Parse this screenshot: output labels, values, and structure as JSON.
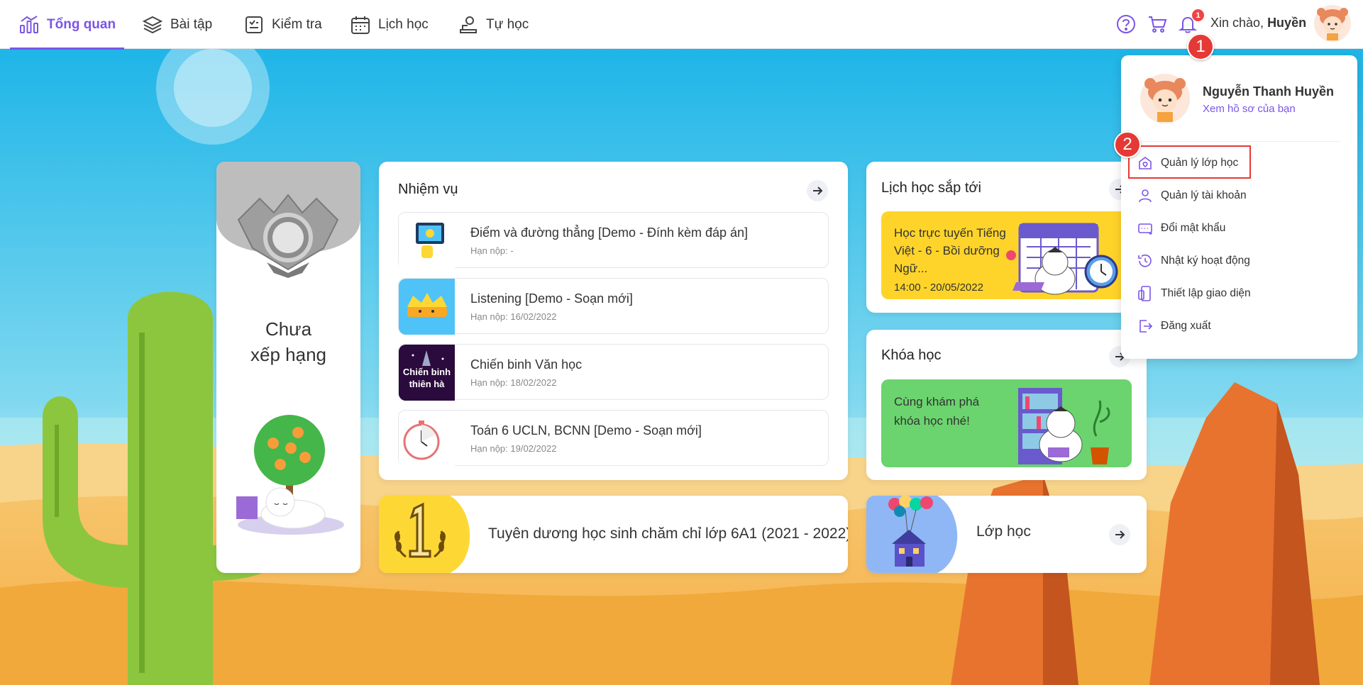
{
  "nav": {
    "items": [
      {
        "label": "Tổng quan",
        "icon": "chart-icon",
        "active": true
      },
      {
        "label": "Bài tập",
        "icon": "layers-icon"
      },
      {
        "label": "Kiểm tra",
        "icon": "test-icon"
      },
      {
        "label": "Lịch học",
        "icon": "calendar-icon"
      },
      {
        "label": "Tự học",
        "icon": "self-study-icon"
      }
    ],
    "notification_count": "1",
    "greeting_prefix": "Xin chào, ",
    "greeting_name": "Huyền"
  },
  "annotations": {
    "step1": "1",
    "step2": "2"
  },
  "rank": {
    "line1": "Chưa",
    "line2": "xếp hạng"
  },
  "tasks": {
    "title": "Nhiệm vụ",
    "items": [
      {
        "name": "Điểm và đường thẳng [Demo - Đính kèm đáp án]",
        "due": "Hạn nộp: -"
      },
      {
        "name": "Listening [Demo - Soạn mới]",
        "due": "Hạn nộp: 16/02/2022"
      },
      {
        "name": "Chiến binh Văn học",
        "due": "Hạn nộp: 18/02/2022",
        "thumb_text": "Chiến binh thiên hà"
      },
      {
        "name": "Toán 6 UCLN, BCNN [Demo - Soạn mới]",
        "due": "Hạn nộp: 19/02/2022"
      }
    ]
  },
  "schedule": {
    "title": "Lịch học sắp tới",
    "event_title": "Học trực tuyến Tiếng Việt - 6 - Bồi dưỡng Ngữ...",
    "event_time": "14:00 - 20/05/2022"
  },
  "courses": {
    "title": "Khóa học",
    "banner_text": "Cùng khám phá khóa học nhé!"
  },
  "award": {
    "title": "Tuyên dương học sinh chăm chỉ lớp 6A1 (2021 - 2022)"
  },
  "classes": {
    "title": "Lớp học"
  },
  "dropdown": {
    "name": "Nguyễn Thanh Huyền",
    "profile_link": "Xem hồ sơ của bạn",
    "items": [
      {
        "label": "Quản lý lớp học",
        "icon": "class-heart-icon"
      },
      {
        "label": "Quản lý tài khoản",
        "icon": "user-icon"
      },
      {
        "label": "Đổi mật khẩu",
        "icon": "password-icon"
      },
      {
        "label": "Nhật ký hoạt động",
        "icon": "history-icon"
      },
      {
        "label": "Thiết lập giao diện",
        "icon": "devices-icon"
      },
      {
        "label": "Đăng xuất",
        "icon": "logout-icon"
      }
    ]
  },
  "colors": {
    "accent": "#7b55e6",
    "highlight": "#e53935",
    "schedule_banner": "#ffd42a",
    "course_banner": "#6bd46e"
  }
}
